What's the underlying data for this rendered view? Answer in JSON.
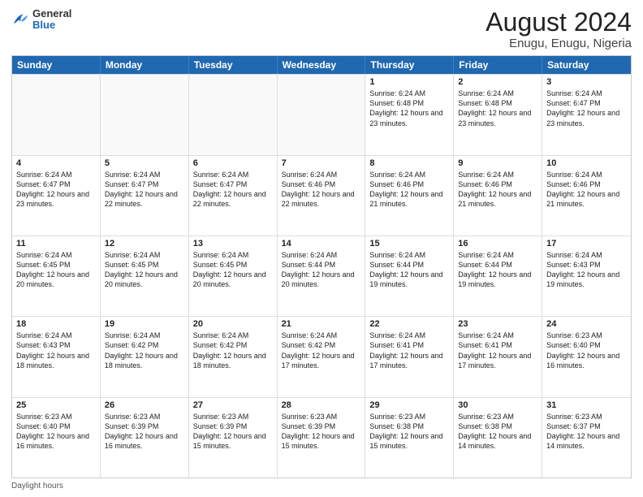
{
  "header": {
    "logo_general": "General",
    "logo_blue": "Blue",
    "title": "August 2024",
    "location": "Enugu, Enugu, Nigeria"
  },
  "days_of_week": [
    "Sunday",
    "Monday",
    "Tuesday",
    "Wednesday",
    "Thursday",
    "Friday",
    "Saturday"
  ],
  "weeks": [
    [
      {
        "day": "",
        "empty": true
      },
      {
        "day": "",
        "empty": true
      },
      {
        "day": "",
        "empty": true
      },
      {
        "day": "",
        "empty": true
      },
      {
        "day": "1",
        "sunrise": "6:24 AM",
        "sunset": "6:48 PM",
        "daylight": "12 hours and 23 minutes."
      },
      {
        "day": "2",
        "sunrise": "6:24 AM",
        "sunset": "6:48 PM",
        "daylight": "12 hours and 23 minutes."
      },
      {
        "day": "3",
        "sunrise": "6:24 AM",
        "sunset": "6:47 PM",
        "daylight": "12 hours and 23 minutes."
      }
    ],
    [
      {
        "day": "4",
        "sunrise": "6:24 AM",
        "sunset": "6:47 PM",
        "daylight": "12 hours and 23 minutes."
      },
      {
        "day": "5",
        "sunrise": "6:24 AM",
        "sunset": "6:47 PM",
        "daylight": "12 hours and 22 minutes."
      },
      {
        "day": "6",
        "sunrise": "6:24 AM",
        "sunset": "6:47 PM",
        "daylight": "12 hours and 22 minutes."
      },
      {
        "day": "7",
        "sunrise": "6:24 AM",
        "sunset": "6:46 PM",
        "daylight": "12 hours and 22 minutes."
      },
      {
        "day": "8",
        "sunrise": "6:24 AM",
        "sunset": "6:46 PM",
        "daylight": "12 hours and 21 minutes."
      },
      {
        "day": "9",
        "sunrise": "6:24 AM",
        "sunset": "6:46 PM",
        "daylight": "12 hours and 21 minutes."
      },
      {
        "day": "10",
        "sunrise": "6:24 AM",
        "sunset": "6:46 PM",
        "daylight": "12 hours and 21 minutes."
      }
    ],
    [
      {
        "day": "11",
        "sunrise": "6:24 AM",
        "sunset": "6:45 PM",
        "daylight": "12 hours and 20 minutes."
      },
      {
        "day": "12",
        "sunrise": "6:24 AM",
        "sunset": "6:45 PM",
        "daylight": "12 hours and 20 minutes."
      },
      {
        "day": "13",
        "sunrise": "6:24 AM",
        "sunset": "6:45 PM",
        "daylight": "12 hours and 20 minutes."
      },
      {
        "day": "14",
        "sunrise": "6:24 AM",
        "sunset": "6:44 PM",
        "daylight": "12 hours and 20 minutes."
      },
      {
        "day": "15",
        "sunrise": "6:24 AM",
        "sunset": "6:44 PM",
        "daylight": "12 hours and 19 minutes."
      },
      {
        "day": "16",
        "sunrise": "6:24 AM",
        "sunset": "6:44 PM",
        "daylight": "12 hours and 19 minutes."
      },
      {
        "day": "17",
        "sunrise": "6:24 AM",
        "sunset": "6:43 PM",
        "daylight": "12 hours and 19 minutes."
      }
    ],
    [
      {
        "day": "18",
        "sunrise": "6:24 AM",
        "sunset": "6:43 PM",
        "daylight": "12 hours and 18 minutes."
      },
      {
        "day": "19",
        "sunrise": "6:24 AM",
        "sunset": "6:42 PM",
        "daylight": "12 hours and 18 minutes."
      },
      {
        "day": "20",
        "sunrise": "6:24 AM",
        "sunset": "6:42 PM",
        "daylight": "12 hours and 18 minutes."
      },
      {
        "day": "21",
        "sunrise": "6:24 AM",
        "sunset": "6:42 PM",
        "daylight": "12 hours and 17 minutes."
      },
      {
        "day": "22",
        "sunrise": "6:24 AM",
        "sunset": "6:41 PM",
        "daylight": "12 hours and 17 minutes."
      },
      {
        "day": "23",
        "sunrise": "6:24 AM",
        "sunset": "6:41 PM",
        "daylight": "12 hours and 17 minutes."
      },
      {
        "day": "24",
        "sunrise": "6:23 AM",
        "sunset": "6:40 PM",
        "daylight": "12 hours and 16 minutes."
      }
    ],
    [
      {
        "day": "25",
        "sunrise": "6:23 AM",
        "sunset": "6:40 PM",
        "daylight": "12 hours and 16 minutes."
      },
      {
        "day": "26",
        "sunrise": "6:23 AM",
        "sunset": "6:39 PM",
        "daylight": "12 hours and 16 minutes."
      },
      {
        "day": "27",
        "sunrise": "6:23 AM",
        "sunset": "6:39 PM",
        "daylight": "12 hours and 15 minutes."
      },
      {
        "day": "28",
        "sunrise": "6:23 AM",
        "sunset": "6:39 PM",
        "daylight": "12 hours and 15 minutes."
      },
      {
        "day": "29",
        "sunrise": "6:23 AM",
        "sunset": "6:38 PM",
        "daylight": "12 hours and 15 minutes."
      },
      {
        "day": "30",
        "sunrise": "6:23 AM",
        "sunset": "6:38 PM",
        "daylight": "12 hours and 14 minutes."
      },
      {
        "day": "31",
        "sunrise": "6:23 AM",
        "sunset": "6:37 PM",
        "daylight": "12 hours and 14 minutes."
      }
    ]
  ],
  "footer": {
    "daylight_label": "Daylight hours"
  }
}
